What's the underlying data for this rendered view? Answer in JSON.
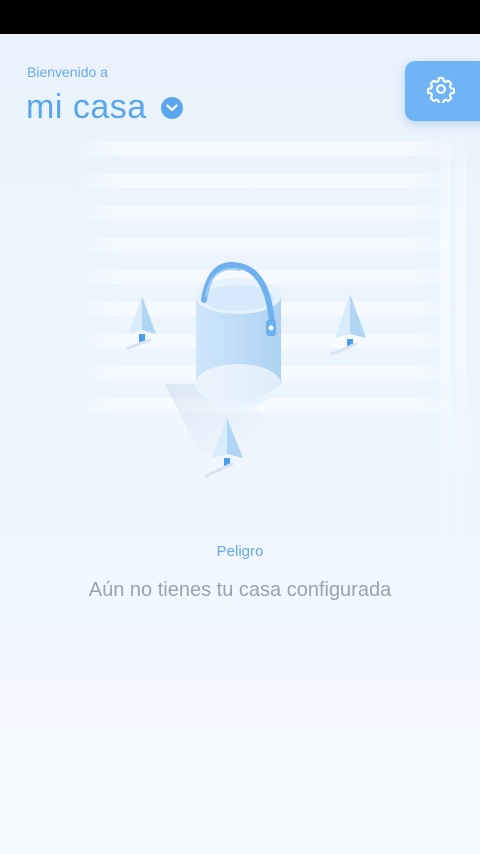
{
  "header": {
    "welcome_text": "Bienvenido a",
    "home_name": "mi casa"
  },
  "content": {
    "status_label": "Peligro",
    "empty_message": "Aún no tienes tu casa configurada"
  },
  "icons": {
    "settings": "gear-icon",
    "home_selector": "chevron-down-icon",
    "illustration": "bucket-illustration"
  },
  "colors": {
    "accent": "#5aa6ec",
    "settings_button": "#6fb4f4",
    "status_label": "#69a8e4",
    "message_text": "#9aa3ad"
  }
}
